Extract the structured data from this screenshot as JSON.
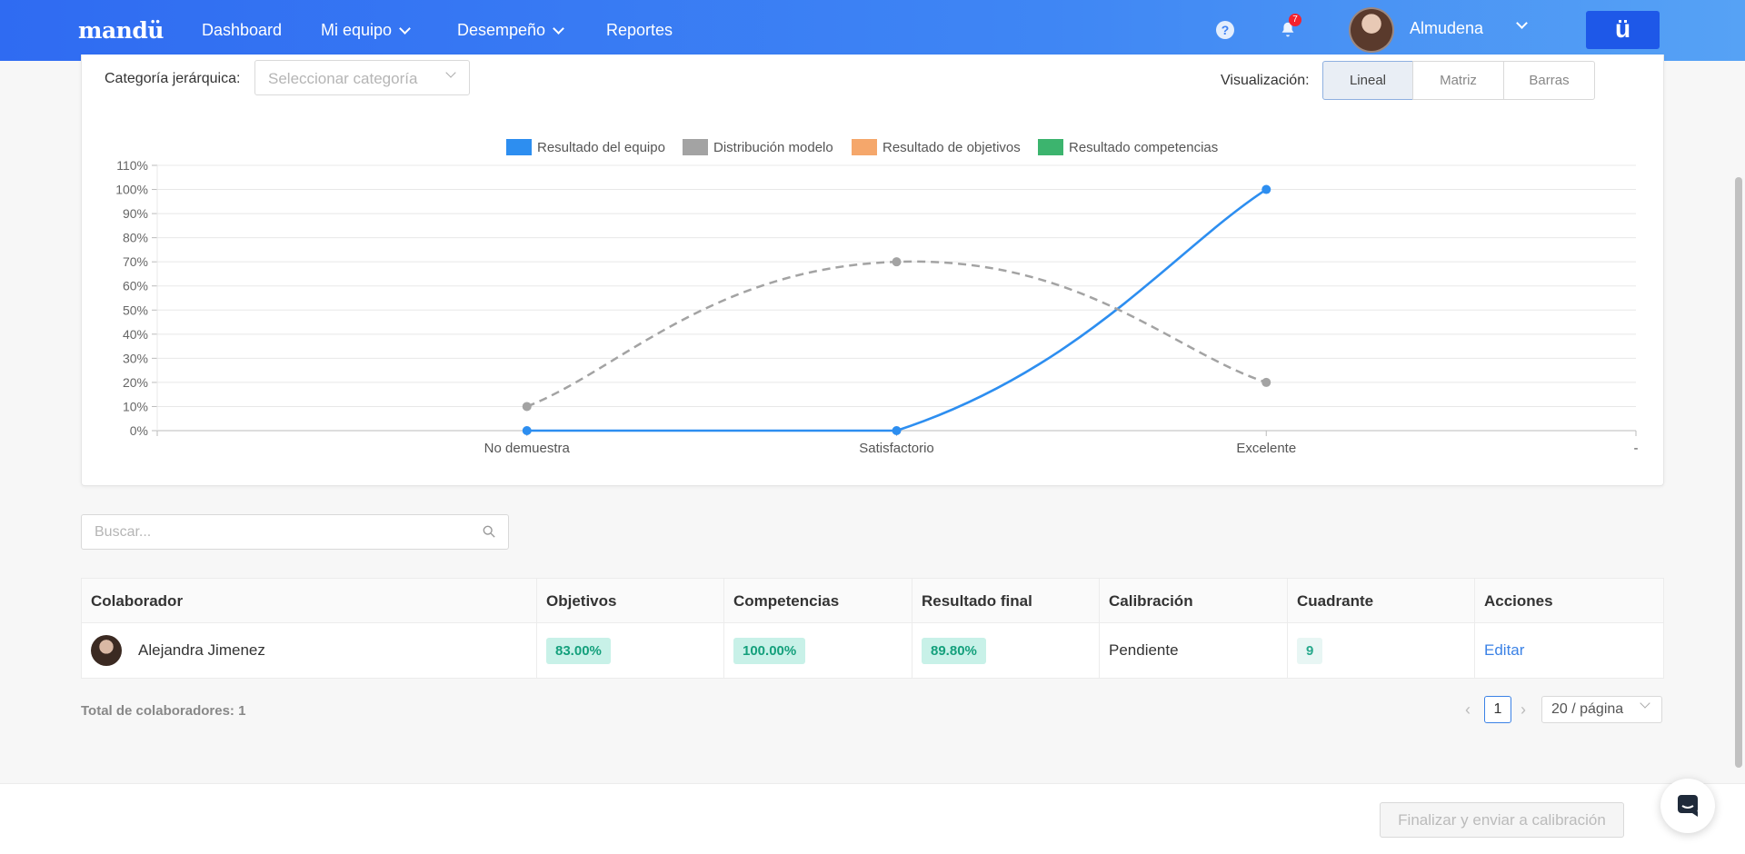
{
  "nav": {
    "logo": "mandü",
    "items": [
      {
        "label": "Dashboard",
        "has_chevron": false
      },
      {
        "label": "Mi equipo",
        "has_chevron": true
      },
      {
        "label": "Desempeño",
        "has_chevron": true
      },
      {
        "label": "Reportes",
        "has_chevron": false
      }
    ],
    "notification_count": "7",
    "user_name": "Almudena",
    "brand_button": "ü"
  },
  "filters": {
    "category_label": "Categoría jerárquica:",
    "category_placeholder": "Seleccionar categoría",
    "visualization_label": "Visualización:",
    "view_options": [
      "Lineal",
      "Matriz",
      "Barras"
    ],
    "active_view": "Lineal"
  },
  "chart_data": {
    "type": "line",
    "categories": [
      "",
      "No demuestra",
      "Satisfactorio",
      "Excelente",
      "-"
    ],
    "y_ticks": [
      "0%",
      "10%",
      "20%",
      "30%",
      "40%",
      "50%",
      "60%",
      "70%",
      "80%",
      "90%",
      "100%",
      "110%"
    ],
    "ylim": [
      0,
      110
    ],
    "grid": true,
    "legend_position": "top",
    "series": [
      {
        "name": "Resultado del equipo",
        "color": "#2d8ef0",
        "style": "solid",
        "values": [
          null,
          0,
          0,
          100,
          null
        ]
      },
      {
        "name": "Distribución modelo",
        "color": "#a3a3a3",
        "style": "dashed",
        "values": [
          null,
          10,
          70,
          20,
          null
        ]
      },
      {
        "name": "Resultado de objetivos",
        "color": "#f5a76b",
        "style": "solid",
        "values": []
      },
      {
        "name": "Resultado competencias",
        "color": "#3cb46e",
        "style": "solid",
        "values": []
      }
    ]
  },
  "search": {
    "placeholder": "Buscar..."
  },
  "table": {
    "headers": [
      "Colaborador",
      "Objetivos",
      "Competencias",
      "Resultado final",
      "Calibración",
      "Cuadrante",
      "Acciones"
    ],
    "rows": [
      {
        "name": "Alejandra Jimenez",
        "objetivos": "83.00%",
        "competencias": "100.00%",
        "resultado_final": "89.80%",
        "calibracion": "Pendiente",
        "cuadrante": "9",
        "accion": "Editar"
      }
    ]
  },
  "pagination": {
    "total_label": "Total de colaboradores: 1",
    "current_page": "1",
    "page_size": "20 / página"
  },
  "footer": {
    "finalize_label": "Finalizar y enviar a calibración"
  }
}
